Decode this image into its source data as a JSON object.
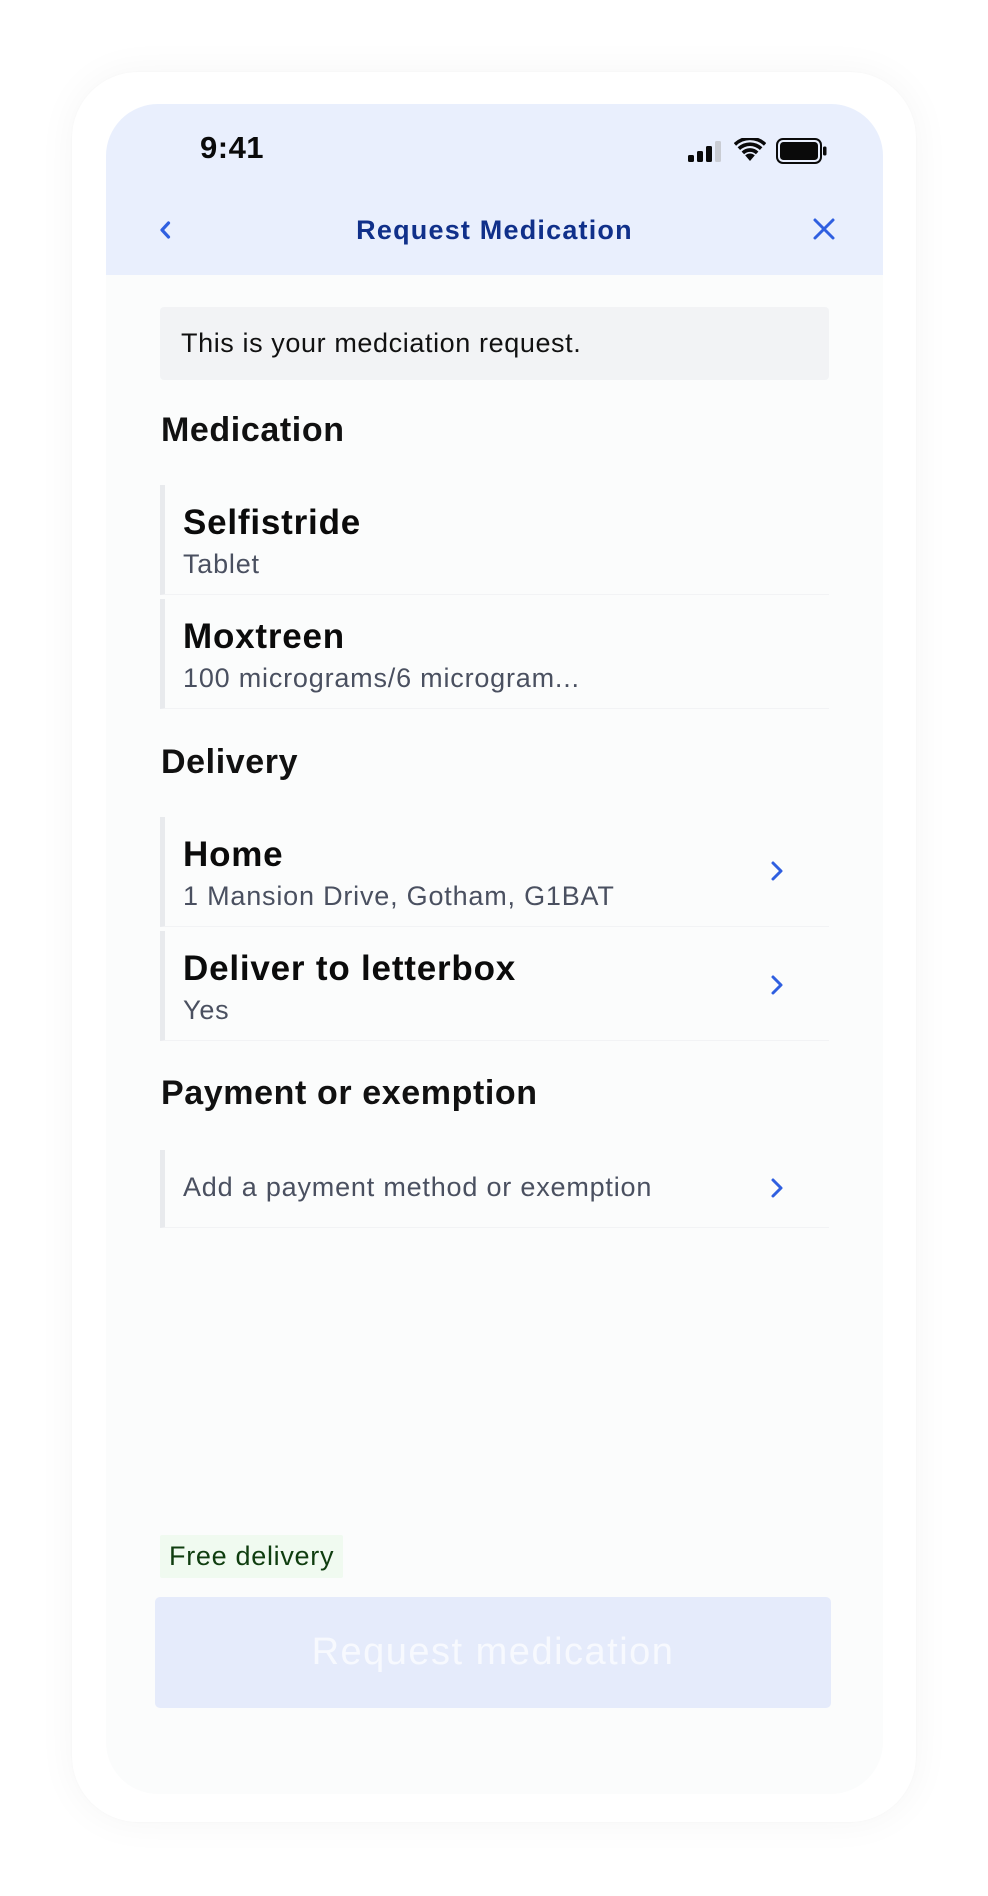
{
  "status_bar": {
    "time": "9:41"
  },
  "nav": {
    "title": "Request Medication",
    "back_icon": "chevron-left-icon",
    "close_icon": "close-icon"
  },
  "banner": {
    "text": "This is your medciation request."
  },
  "medication": {
    "heading": "Medication",
    "items": [
      {
        "title": "Selfistride",
        "subtitle": "Tablet"
      },
      {
        "title": "Moxtreen",
        "subtitle": "100 micrograms/6 microgram..."
      }
    ]
  },
  "delivery": {
    "heading": "Delivery",
    "items": [
      {
        "title": "Home",
        "subtitle": "1 Mansion Drive, Gotham, G1BAT"
      },
      {
        "title": "Deliver to letterbox",
        "subtitle": "Yes"
      }
    ]
  },
  "payment": {
    "heading": "Payment or exemption",
    "placeholder": "Add a payment method or exemption"
  },
  "footer": {
    "badge": "Free delivery",
    "button_label": "Request medication"
  },
  "colors": {
    "header_bg": "#e9effd",
    "title_blue": "#10308a",
    "accent_blue": "#2f5fe0",
    "badge_bg": "#f0faf0",
    "badge_text": "#0f3d0f",
    "button_disabled_bg": "#e5ebfb"
  }
}
